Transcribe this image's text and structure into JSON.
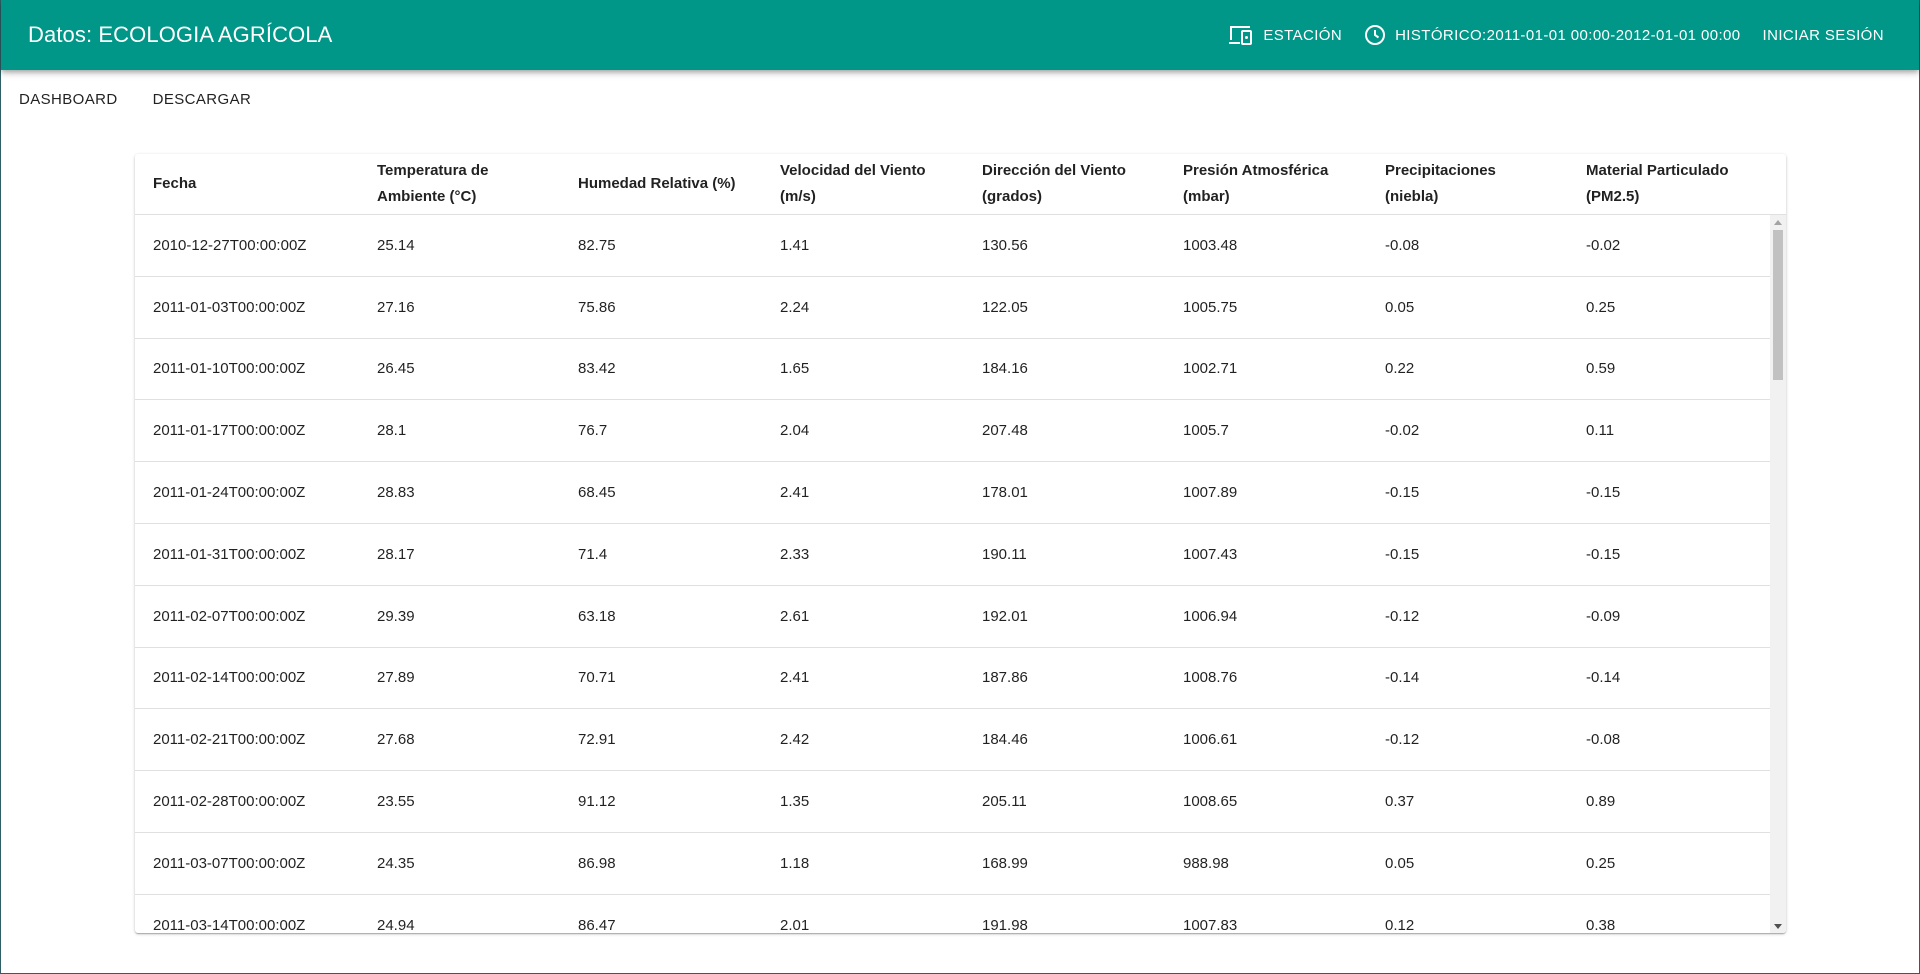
{
  "appbar": {
    "title": "Datos: ECOLOGIA AGRÍCOLA",
    "station_label": "ESTACIÓN",
    "history_label": "HISTÓRICO:2011-01-01 00:00-2012-01-01 00:00",
    "login_label": "INICIAR SESIÓN",
    "background_color": "#009688"
  },
  "tabs": [
    {
      "label": "DASHBOARD"
    },
    {
      "label": "DESCARGAR"
    }
  ],
  "table": {
    "headers": [
      {
        "line1": "Fecha",
        "line2": ""
      },
      {
        "line1": "Temperatura de",
        "line2": "Ambiente (°C)"
      },
      {
        "line1": "Humedad Relativa (%)",
        "line2": ""
      },
      {
        "line1": "Velocidad del Viento",
        "line2": "(m/s)"
      },
      {
        "line1": "Dirección del Viento",
        "line2": "(grados)"
      },
      {
        "line1": "Presión Atmosférica",
        "line2": "(mbar)"
      },
      {
        "line1": "Precipitaciones",
        "line2": "(niebla)"
      },
      {
        "line1": "Material Particulado",
        "line2": "(PM2.5)"
      }
    ],
    "rows": [
      [
        "2010-12-27T00:00:00Z",
        "25.14",
        "82.75",
        "1.41",
        "130.56",
        "1003.48",
        "-0.08",
        "-0.02"
      ],
      [
        "2011-01-03T00:00:00Z",
        "27.16",
        "75.86",
        "2.24",
        "122.05",
        "1005.75",
        "0.05",
        "0.25"
      ],
      [
        "2011-01-10T00:00:00Z",
        "26.45",
        "83.42",
        "1.65",
        "184.16",
        "1002.71",
        "0.22",
        "0.59"
      ],
      [
        "2011-01-17T00:00:00Z",
        "28.1",
        "76.7",
        "2.04",
        "207.48",
        "1005.7",
        "-0.02",
        "0.11"
      ],
      [
        "2011-01-24T00:00:00Z",
        "28.83",
        "68.45",
        "2.41",
        "178.01",
        "1007.89",
        "-0.15",
        "-0.15"
      ],
      [
        "2011-01-31T00:00:00Z",
        "28.17",
        "71.4",
        "2.33",
        "190.11",
        "1007.43",
        "-0.15",
        "-0.15"
      ],
      [
        "2011-02-07T00:00:00Z",
        "29.39",
        "63.18",
        "2.61",
        "192.01",
        "1006.94",
        "-0.12",
        "-0.09"
      ],
      [
        "2011-02-14T00:00:00Z",
        "27.89",
        "70.71",
        "2.41",
        "187.86",
        "1008.76",
        "-0.14",
        "-0.14"
      ],
      [
        "2011-02-21T00:00:00Z",
        "27.68",
        "72.91",
        "2.42",
        "184.46",
        "1006.61",
        "-0.12",
        "-0.08"
      ],
      [
        "2011-02-28T00:00:00Z",
        "23.55",
        "91.12",
        "1.35",
        "205.11",
        "1008.65",
        "0.37",
        "0.89"
      ],
      [
        "2011-03-07T00:00:00Z",
        "24.35",
        "86.98",
        "1.18",
        "168.99",
        "988.98",
        "0.05",
        "0.25"
      ],
      [
        "2011-03-14T00:00:00Z",
        "24.94",
        "86.47",
        "2.01",
        "191.98",
        "1007.83",
        "0.12",
        "0.38"
      ]
    ]
  },
  "icons": {
    "station": "devices-icon",
    "history": "clock-icon"
  }
}
